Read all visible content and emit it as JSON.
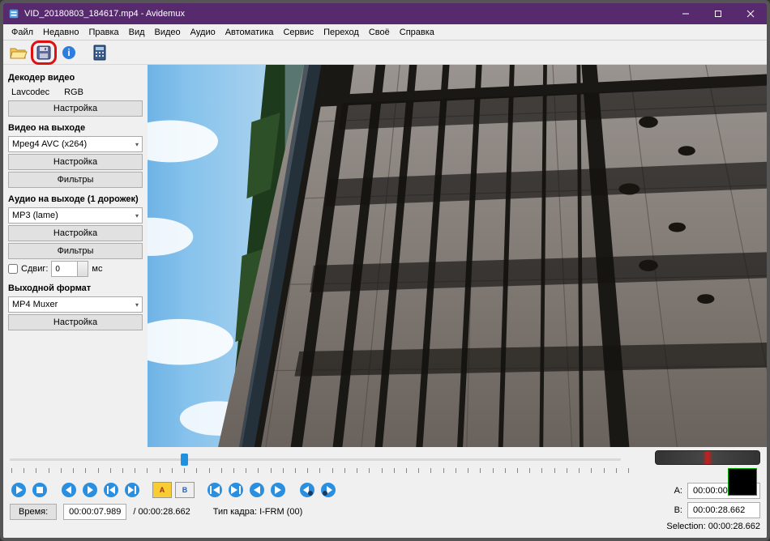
{
  "title": "VID_20180803_184617.mp4 - Avidemux",
  "menu": [
    "Файл",
    "Недавно",
    "Правка",
    "Вид",
    "Видео",
    "Аудио",
    "Автоматика",
    "Сервис",
    "Переход",
    "Своё",
    "Справка"
  ],
  "sidebar": {
    "decoder_hdr": "Декодер видео",
    "lavcodec": "Lavcodec",
    "rgb": "RGB",
    "settings": "Настройка",
    "video_out_hdr": "Видео на выходе",
    "video_codec": "Mpeg4 AVC (x264)",
    "filters": "Фильтры",
    "audio_out_hdr": "Аудио на выходе (1 дорожек)",
    "audio_codec": "MP3 (lame)",
    "shift_label": "Сдвиг:",
    "shift_val": "0",
    "shift_unit": "мс",
    "out_fmt_hdr": "Выходной формат",
    "out_fmt": "MP4 Muxer"
  },
  "bottom": {
    "time_label": "Время:",
    "time_val": "00:00:07.989",
    "duration": "/ 00:00:28.662",
    "frame_type": "Тип кадра:  I-FRM (00)",
    "a_label": "A:",
    "a_val": "00:00:00.000",
    "b_label": "B:",
    "b_val": "00:00:28.662",
    "sel_label": "Selection: 00:00:28.662"
  }
}
